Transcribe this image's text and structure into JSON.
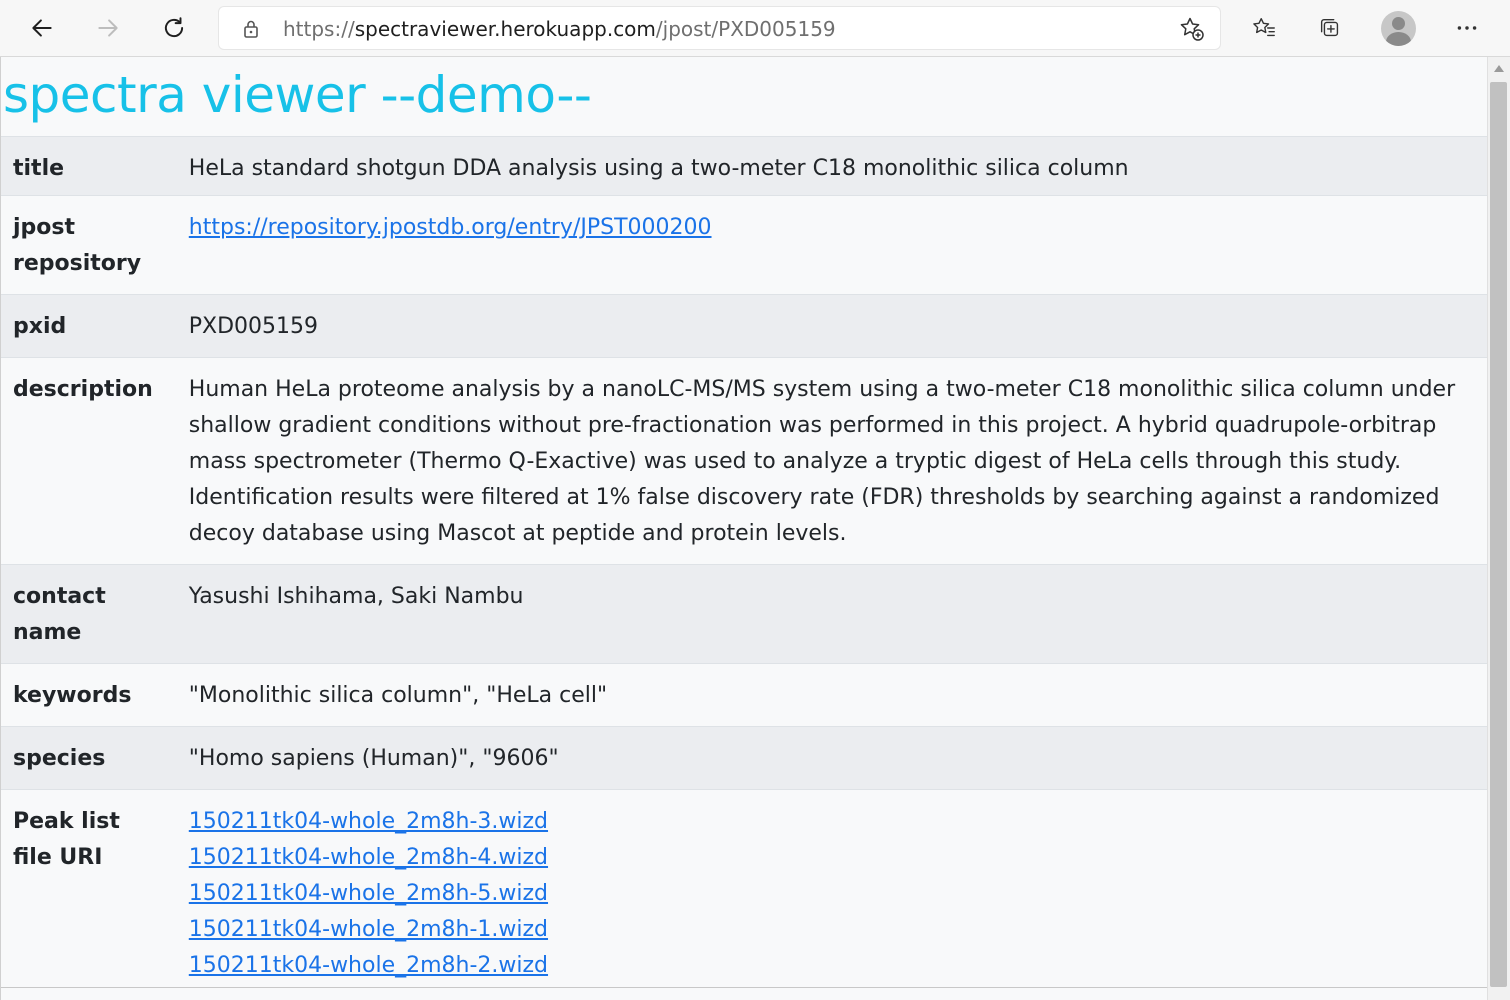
{
  "browser": {
    "url_prefix": "https://",
    "url_host": "spectraviewer.herokuapp.com",
    "url_path": "/jpost/PXD005159",
    "icons": [
      "back-icon",
      "forward-icon",
      "refresh-icon",
      "lock-icon",
      "add-favorite-icon",
      "favorites-icon",
      "collections-icon",
      "profile-avatar",
      "more-icon"
    ]
  },
  "page": {
    "heading": "spectra viewer --demo--"
  },
  "rows": [
    {
      "key": "title",
      "value": "HeLa standard shotgun DDA analysis using a two-meter C18 monolithic silica column"
    },
    {
      "key": "jpost repository",
      "value": "https://repository.jpostdb.org/entry/JPST000200"
    },
    {
      "key": "pxid",
      "value": "PXD005159"
    },
    {
      "key": "description",
      "value": "Human HeLa proteome analysis by a nanoLC-MS/MS system using a two-meter C18 monolithic silica column under shallow gradient conditions without pre-fractionation was performed in this project. A hybrid quadrupole-orbitrap mass spectrometer (Thermo Q-Exactive) was used to analyze a tryptic digest of HeLa cells through this study. Identification results were filtered at 1% false discovery rate (FDR) thresholds by searching against a randomized decoy database using Mascot at peptide and protein levels."
    },
    {
      "key": "contact name",
      "value": "Yasushi Ishihama, Saki Nambu"
    },
    {
      "key": "keywords",
      "value": "\"Monolithic silica column\", \"HeLa cell\""
    },
    {
      "key": "species",
      "value": "\"Homo sapiens (Human)\", \"9606\""
    },
    {
      "key": "Peak list file URI",
      "files": [
        "150211tk04-whole_2m8h-3.wizd",
        "150211tk04-whole_2m8h-4.wizd",
        "150211tk04-whole_2m8h-5.wizd",
        "150211tk04-whole_2m8h-1.wizd",
        "150211tk04-whole_2m8h-2.wizd"
      ]
    }
  ],
  "colors": {
    "heading": "#17c1e8",
    "link": "#1a73e8",
    "row_odd": "#ebedf0",
    "row_even": "#f8f9fa"
  }
}
